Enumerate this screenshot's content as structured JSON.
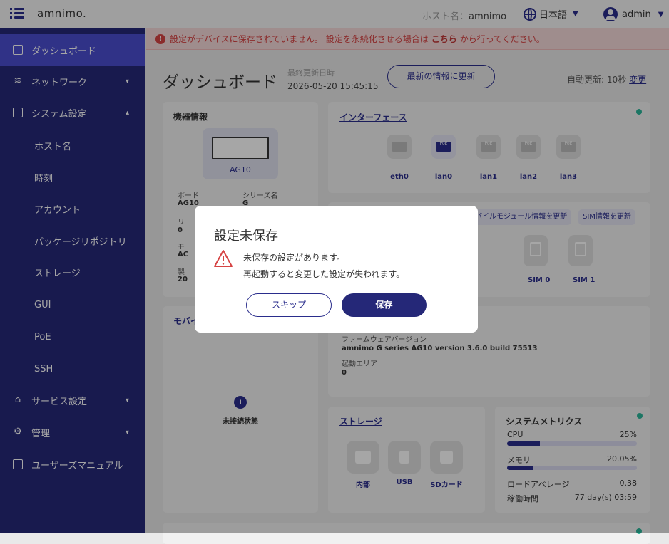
{
  "header": {
    "logo": "amnimo.",
    "host_label": "ホスト名：",
    "host_value": "amnimo",
    "language": "日本語",
    "user": "admin"
  },
  "sidebar": {
    "items": [
      {
        "label": "ダッシュボード",
        "icon": "dashboard-icon"
      },
      {
        "label": "ネットワーク",
        "icon": "wifi-icon"
      },
      {
        "label": "システム設定",
        "icon": "server-icon"
      },
      {
        "label": "ホスト名"
      },
      {
        "label": "時刻"
      },
      {
        "label": "アカウント"
      },
      {
        "label": "パッケージリポジトリ"
      },
      {
        "label": "ストレージ"
      },
      {
        "label": "GUI"
      },
      {
        "label": "PoE"
      },
      {
        "label": "SSH"
      },
      {
        "label": "サービス設定",
        "icon": "service-icon"
      },
      {
        "label": "管理",
        "icon": "gear-icon"
      },
      {
        "label": "ユーザーズマニュアル",
        "icon": "manual-icon"
      }
    ]
  },
  "alert": {
    "text_before": "設定がデバイスに保存されていません。 設定を永続化させる場合は",
    "link": "こちら",
    "text_after": "から行ってください。"
  },
  "dashboard": {
    "title": "ダッシュボード",
    "last_updated_label": "最終更新日時",
    "last_updated": "2026-05-20 15:45:15",
    "refresh_button": "最新の情報に更新",
    "auto_refresh": "自動更新: 10秒",
    "change_link": "変更"
  },
  "device_info": {
    "title": "機器情報",
    "model_image": "AG10",
    "board_label": "ボード",
    "board_value": "AG10",
    "series_label": "シリーズ名",
    "series_value": "G",
    "r_label": "リ",
    "r_value": "0",
    "m_label": "モ",
    "m_value": "AC",
    "s_label": "製",
    "s_value": "20"
  },
  "interface": {
    "title": "インターフェース",
    "ports": [
      {
        "label": "eth0",
        "poe": ""
      },
      {
        "label": "lan0",
        "poe": "PoE"
      },
      {
        "label": "lan1",
        "poe": "PoE"
      },
      {
        "label": "lan2",
        "poe": "PoE"
      },
      {
        "label": "lan3",
        "poe": "PoE"
      }
    ]
  },
  "mobile": {
    "update_module": "バイルモジュール情報を更新",
    "update_sim": "SIM情報を更新",
    "sims": [
      "SIM 0",
      "SIM 1"
    ],
    "title": "モバイ",
    "status": "未接続状態"
  },
  "firmware": {
    "fw_label": "ファームウェアバージョン",
    "fw_value": "amnimo G series AG10 version 3.6.0 build 75513",
    "boot_label": "起動エリア",
    "boot_value": "0"
  },
  "storage": {
    "title": "ストレージ",
    "items": [
      "内部",
      "USB",
      "SDカード"
    ]
  },
  "metrics": {
    "title": "システムメトリクス",
    "cpu_label": "CPU",
    "cpu_value": "25%",
    "cpu_fraction": 0.25,
    "mem_label": "メモリ",
    "mem_value": "20.05%",
    "mem_fraction": 0.2005,
    "load_label": "ロードアベレージ",
    "load_value": "0.38",
    "uptime_label": "稼働時間",
    "uptime_value": "77 day(s) 03:59"
  },
  "modal": {
    "title": "設定未保存",
    "line1": "未保存の設定があります。",
    "line2": "再起動すると変更した設定が失われます。",
    "skip": "スキップ",
    "save": "保存"
  },
  "colors": {
    "brand": "#252878",
    "accent": "#4a4ed0",
    "alert": "#d64343",
    "status_ok": "#2bb59a"
  }
}
